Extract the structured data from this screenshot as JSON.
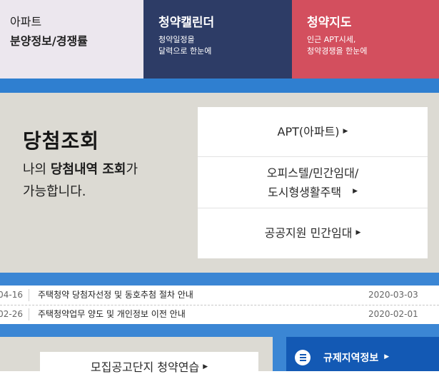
{
  "top_menu": {
    "tile1": {
      "sub": "아파트",
      "main": "분양정보/경쟁률"
    },
    "tile2": {
      "main": "청약캘린더",
      "desc_line1": "청약일정을",
      "desc_line2": "달력으로 한눈에"
    },
    "tile3": {
      "main": "청약지도",
      "desc_line1": "인근 APT시세,",
      "desc_line2": "청약경쟁을 한눈에"
    }
  },
  "lottery": {
    "title": "당첨조회",
    "desc_pre": "나의 ",
    "desc_bold": "당첨내역 조회",
    "desc_post": "가",
    "desc_line2": "가능합니다.",
    "menu": {
      "item1": "APT(아파트)",
      "item2_line1": "오피스텔/민간임대/",
      "item2_line2": "도시형생활주택",
      "item3": "공공지원 민간임대",
      "arrow": "▶"
    }
  },
  "notices": [
    {
      "left_date": "04-16",
      "title": "주택청약 당첨자선정 및 동호추첨 절차 안내",
      "date": "2020-03-03"
    },
    {
      "left_date": "02-26",
      "title": "주택청약업무 양도 및 개인정보 이전 안내",
      "date": "2020-02-01"
    }
  ],
  "bottom": {
    "demo_label": "모집공고단지 청약연습",
    "region_label": "규제지역정보",
    "arrow": "▶"
  },
  "colors": {
    "navy": "#2d3c66",
    "red": "#d34f5e",
    "blue": "#3b86d4",
    "dark_blue": "#1359b4",
    "beige": "#dcdad3"
  }
}
